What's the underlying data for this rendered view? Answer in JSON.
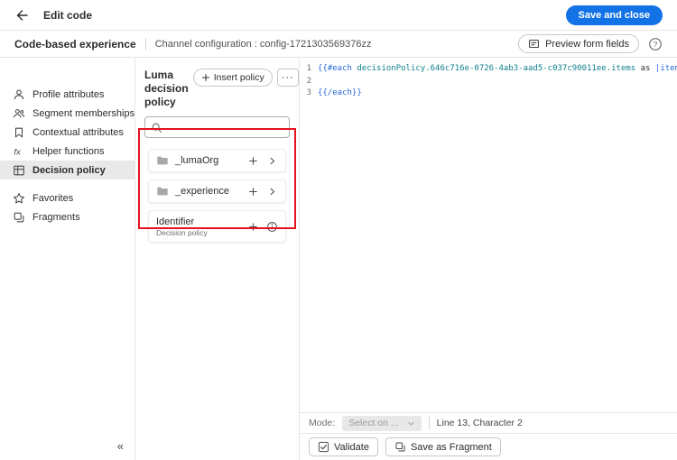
{
  "colors": {
    "accent_blue": "#1373e6",
    "annotation_red": "#e6131e",
    "code_keyword": "#2667d9",
    "code_path": "#0d7f89",
    "selected_item_bg": "#e9e9e9"
  },
  "icons": {
    "help": "?",
    "fx": "fx",
    "more": "···"
  },
  "header": {
    "title": "Edit code",
    "save_button": "Save and close"
  },
  "subheader": {
    "title": "Code-based experience",
    "channel": "Channel configuration : config-1721303569376zz",
    "preview_button": "Preview form fields"
  },
  "sidebar": {
    "collapse": "«",
    "items": [
      {
        "label": "Profile attributes",
        "icon": "person-icon"
      },
      {
        "label": "Segment memberships",
        "icon": "people-icon"
      },
      {
        "label": "Contextual attributes",
        "icon": "bookmark-icon"
      },
      {
        "label": "Helper functions",
        "icon": "fx-icon"
      },
      {
        "label": "Decision policy",
        "icon": "grid-icon",
        "selected": true
      },
      {
        "label": "Favorites",
        "icon": "star-icon"
      },
      {
        "label": "Fragments",
        "icon": "fragment-icon"
      }
    ]
  },
  "policy": {
    "title": "Luma decision policy",
    "insert_button": "Insert policy",
    "items": [
      {
        "name": "_lumaOrg",
        "type": "folder",
        "actions": [
          "add",
          "expand"
        ]
      },
      {
        "name": "_experience",
        "type": "folder",
        "actions": [
          "add",
          "expand"
        ]
      },
      {
        "name": "Identifier",
        "subtitle": "Decision policy",
        "actions": [
          "add",
          "info"
        ]
      }
    ]
  },
  "editor": {
    "lines": [
      {
        "number": "1",
        "tokens": [
          {
            "text": "{{#each ",
            "type": "keyword"
          },
          {
            "text": "decisionPolicy.646c716e-0726-4ab3-aad5-c037c90011ee.items",
            "type": "path"
          },
          {
            "text": " as ",
            "type": "plain"
          },
          {
            "text": "|item|",
            "type": "keyword"
          },
          {
            "text": "}}",
            "type": "keyword"
          }
        ]
      },
      {
        "number": "2",
        "tokens": []
      },
      {
        "number": "3",
        "tokens": [
          {
            "text": "{{/each}}",
            "type": "keyword"
          }
        ]
      }
    ],
    "status": {
      "mode_label": "Mode:",
      "mode_value": "Select on ...",
      "position": "Line 13, Character 2"
    },
    "validate_button": "Validate",
    "fragment_button": "Save as Fragment"
  }
}
